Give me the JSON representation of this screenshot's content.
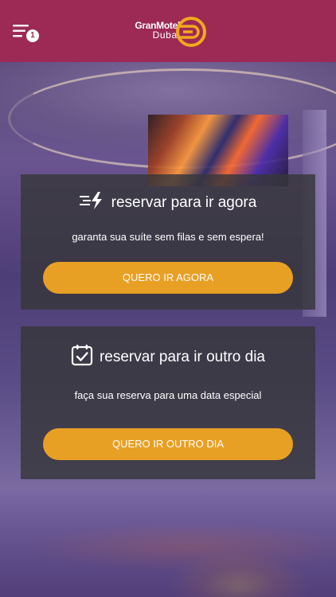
{
  "header": {
    "menu_icon": "menu-icon",
    "menu_badge": "1",
    "logo_line1": "GranMotel",
    "logo_line2": "Dubai",
    "background_color": "#9c2a55",
    "accent_color": "#f2a81d"
  },
  "cards": {
    "now": {
      "icon": "fast-lightning-icon",
      "title": "reservar para ir agora",
      "subtitle": "garanta sua suíte sem filas e sem espera!",
      "button_label": "QUERO IR AGORA"
    },
    "other_day": {
      "icon": "calendar-check-icon",
      "title": "reservar para ir outro dia",
      "subtitle": "faça sua reserva para uma data especial",
      "button_label": "QUERO IR OUTRO DIA"
    }
  },
  "colors": {
    "button": "#e8a024",
    "card": "#373739"
  }
}
